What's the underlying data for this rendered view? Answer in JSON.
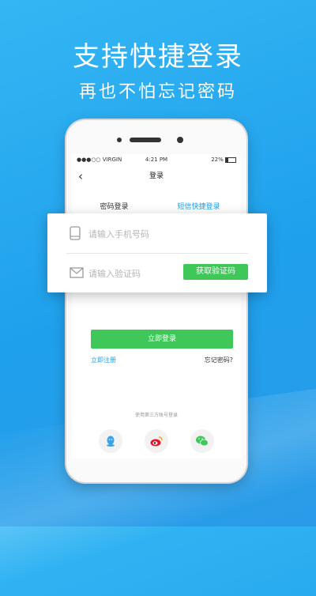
{
  "promo": {
    "headline": "支持快捷登录",
    "subline": "再也不怕忘记密码"
  },
  "statusbar": {
    "carrier": "●●●○○ VIRGIN",
    "time": "4:21 PM",
    "battery": "22%"
  },
  "nav": {
    "back_label": "‹",
    "title": "登录"
  },
  "tabs": [
    {
      "label": "密码登录",
      "active": false
    },
    {
      "label": "短信快捷登录",
      "active": true
    }
  ],
  "form": {
    "phone_placeholder": "请输入手机号码",
    "code_placeholder": "请输入验证码",
    "get_code_label": "获取验证码",
    "login_label": "立即登录",
    "register_label": "立即注册",
    "forgot_label": "忘记密码?"
  },
  "third_party": {
    "label": "使用第三方账号登录",
    "providers": [
      "qq-icon",
      "weibo-icon",
      "wechat-icon"
    ]
  },
  "colors": {
    "accent_blue": "#1fa0ec",
    "accent_green": "#3fc75a"
  }
}
